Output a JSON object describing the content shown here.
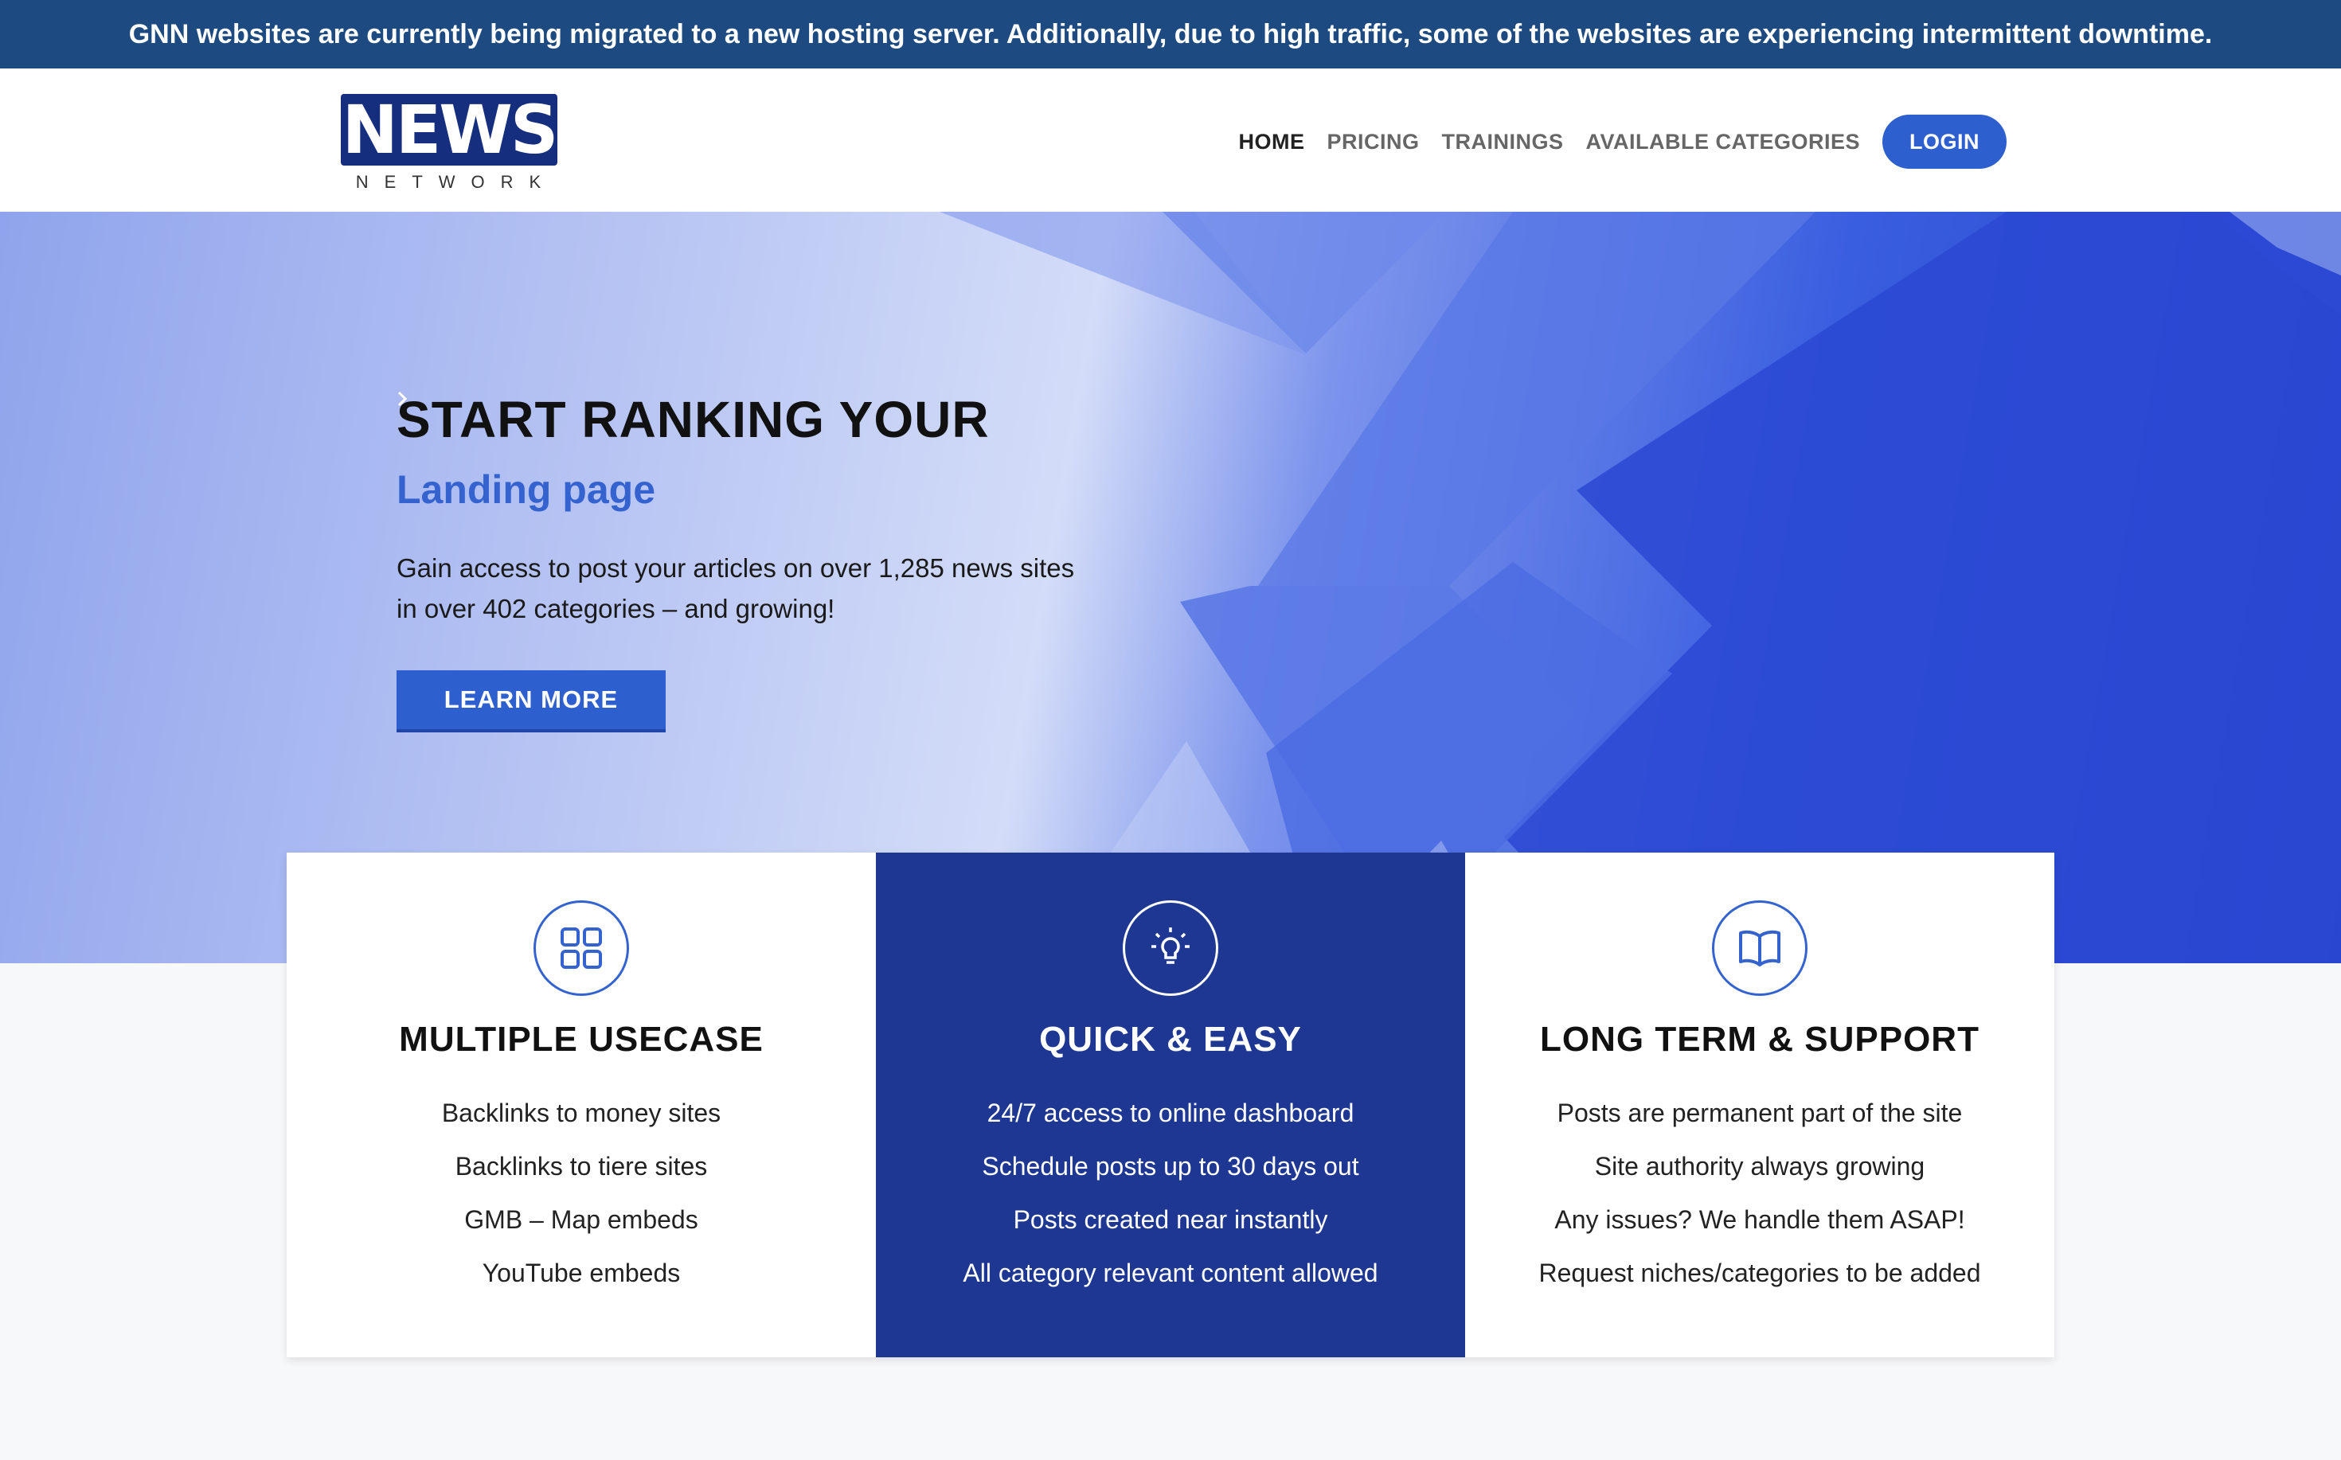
{
  "announcement": "GNN websites are currently being migrated to a new hosting server. Additionally, due to high traffic, some of the websites are experiencing intermittent downtime.",
  "logo": {
    "main": "NEWS",
    "sub": "NETWORK"
  },
  "nav": {
    "items": [
      {
        "label": "HOME",
        "active": true
      },
      {
        "label": "PRICING",
        "active": false
      },
      {
        "label": "TRAININGS",
        "active": false
      },
      {
        "label": "AVAILABLE CATEGORIES",
        "active": false
      }
    ],
    "login_label": "LOGIN"
  },
  "hero": {
    "title": "START RANKING YOUR",
    "subtitle": "Landing page",
    "description": "Gain access to post your articles on over 1,285 news sites in over 402 categories – and growing!",
    "button_label": "LEARN MORE",
    "button_icon": "chevron-right-icon"
  },
  "cards": [
    {
      "icon": "grid-icon",
      "title": "MULTIPLE USECASE",
      "items": [
        "Backlinks to money sites",
        "Backlinks to tiere sites",
        "GMB – Map embeds",
        "YouTube embeds"
      ]
    },
    {
      "icon": "lightbulb-icon",
      "title": "QUICK & EASY",
      "items": [
        "24/7 access to online dashboard",
        "Schedule posts up to 30 days out",
        "Posts created near instantly",
        "All category relevant content allowed"
      ]
    },
    {
      "icon": "book-icon",
      "title": "LONG TERM & SUPPORT",
      "items": [
        "Posts are permanent part of the site",
        "Site authority always growing",
        "Any issues? We handle them ASAP!",
        "Request niches/categories to be added"
      ]
    }
  ],
  "colors": {
    "announcement_bg": "#1d4a80",
    "accent": "#2e5fcf",
    "featured_card_bg": "#1e3792",
    "logo_bg": "#162e7e"
  }
}
